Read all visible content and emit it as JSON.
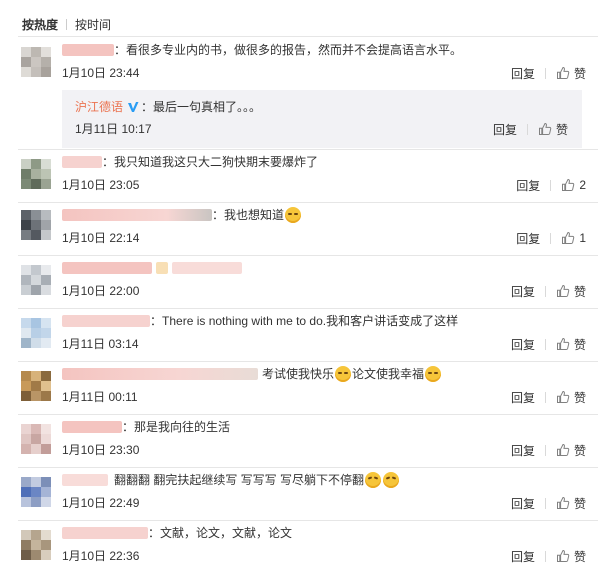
{
  "tabs": {
    "hot": "按热度",
    "time": "按时间"
  },
  "actions": {
    "reply": "回复",
    "like": "赞"
  },
  "comments": [
    {
      "text": "看很多专业内的书，做很多的报告，然而并不会提高语言水平。",
      "time": "1月10日 23:44",
      "likes": "赞"
    },
    {
      "text": "我只知道我这只大二狗快期末要爆炸了",
      "time": "1月10日 23:05",
      "likes": "2"
    },
    {
      "text": "我也想知道",
      "time": "1月10日 22:14",
      "likes": "1"
    },
    {
      "text": "",
      "time": "1月10日 22:00",
      "likes": "赞"
    },
    {
      "text": "There is nothing with me to do.我和客户讲话变成了这样",
      "time": "1月11日 03:14",
      "likes": "赞"
    },
    {
      "text_a": "考试使我快乐",
      "text_b": "论文使我幸福",
      "time": "1月11日 00:11",
      "likes": "赞"
    },
    {
      "text": "那是我向往的生活",
      "time": "1月10日 23:30",
      "likes": "赞"
    },
    {
      "text": "翻翻翻 翻完扶起继续写 写写写 写尽躺下不停翻",
      "time": "1月10日 22:49",
      "likes": "赞"
    },
    {
      "text": "文献，论文，文献，论文",
      "time": "1月10日 22:36",
      "likes": "赞"
    }
  ],
  "reply": {
    "author": "沪江德语",
    "text": "最后一句真相了。。。",
    "time": "1月11日 10:17",
    "likes": "赞"
  },
  "colors": {
    "accent": "#eb7350",
    "verified": "#2a9df4",
    "blurred_name": "#f4c4c0"
  },
  "icons": {
    "like": "thumbs-up-icon",
    "verified": "verified-v-icon",
    "emoji": "emoji-icon"
  }
}
